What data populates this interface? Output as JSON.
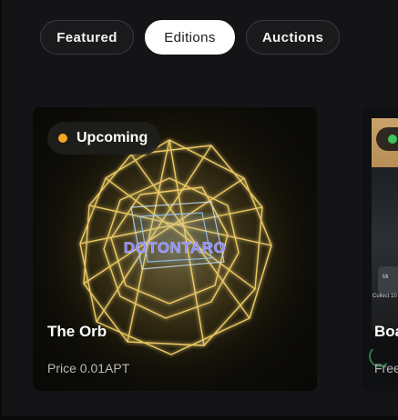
{
  "tabs": [
    {
      "label": "Featured",
      "active": false
    },
    {
      "label": "Editions",
      "active": true
    },
    {
      "label": "Auctions",
      "active": false
    }
  ],
  "cards": [
    {
      "status": "Upcoming",
      "status_color": "#f5a623",
      "title": "The Orb",
      "price": "Price 0.01APT",
      "artwork_text": "DOTONTARO"
    },
    {
      "status_color": "#3ec45a",
      "title": "Boa",
      "price": "Free",
      "mini_label": "Mi",
      "mini_text": "Collect 10"
    }
  ],
  "colors": {
    "background": "#141416",
    "tab_active_bg": "#ffffff",
    "tab_inactive_bg": "#1a1a1d",
    "price_text": "#b9b9b9",
    "orb_glow": "#f6d36b",
    "orb_text": "#8c8cff"
  }
}
